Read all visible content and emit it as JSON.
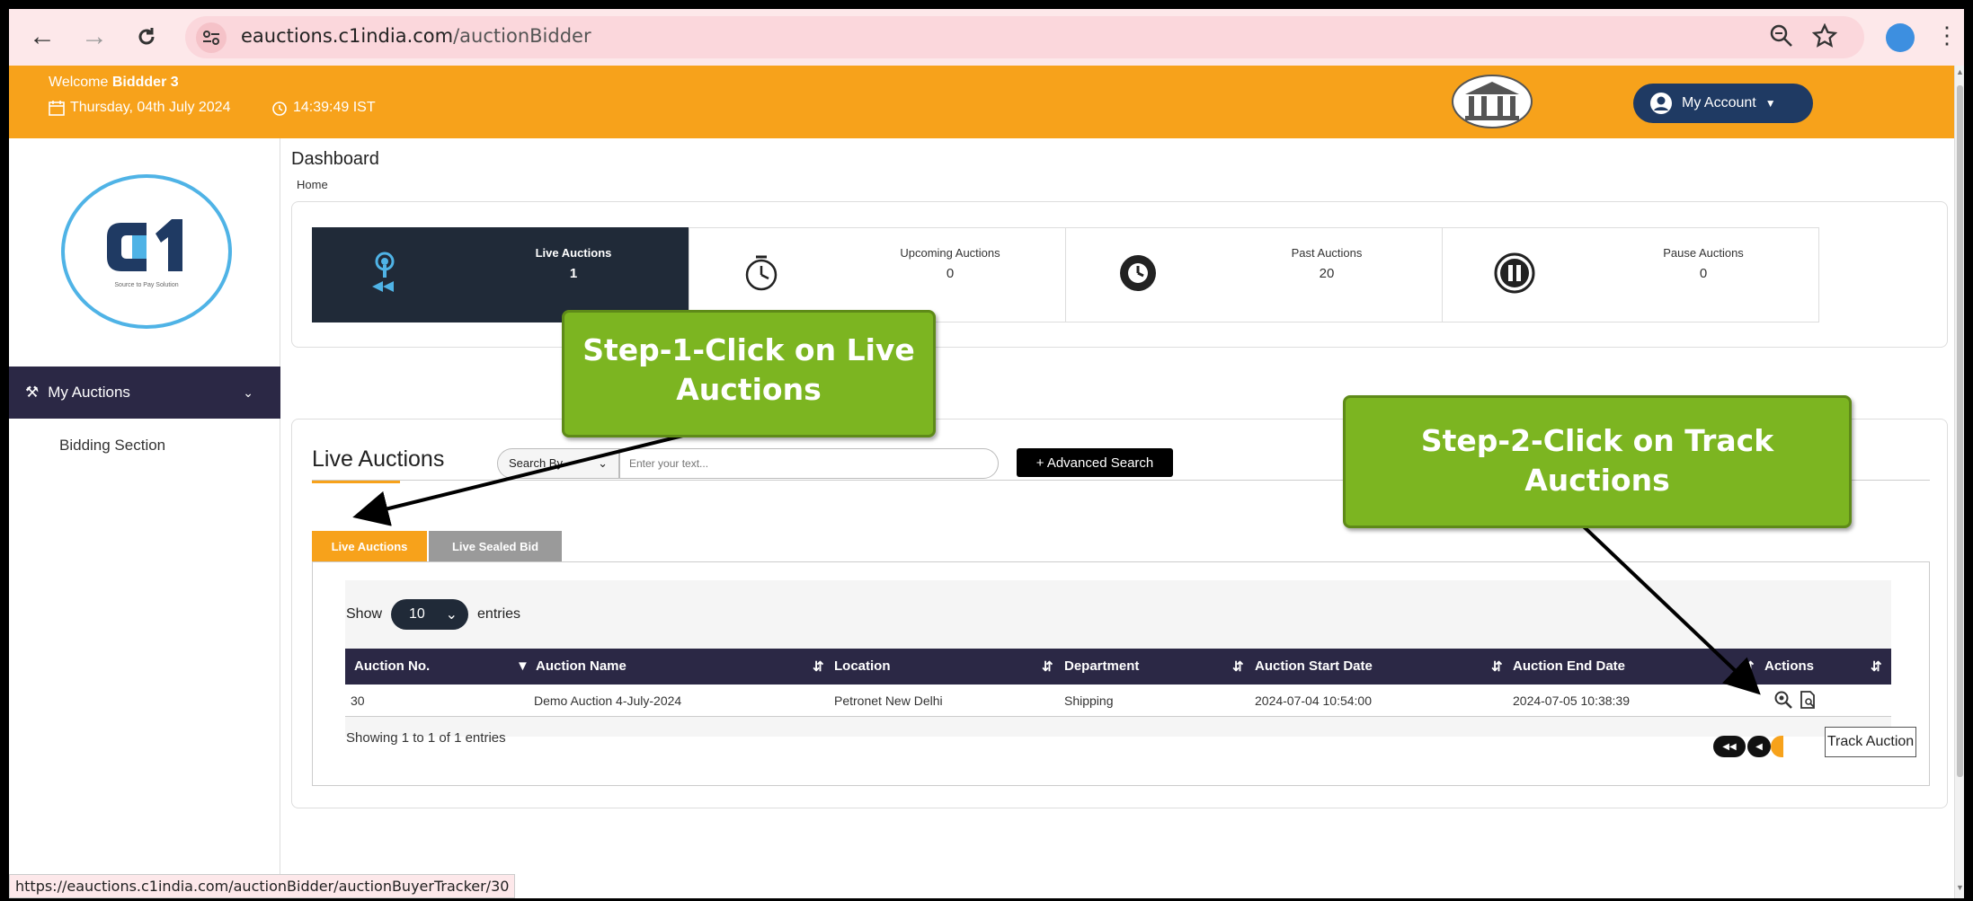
{
  "browser": {
    "url_domain": "eauctions.c1india.com",
    "url_path": "/auctionBidder",
    "status_url": "https://eauctions.c1india.com/auctionBidder/auctionBuyerTracker/30"
  },
  "header": {
    "welcome_prefix": "Welcome ",
    "user_name": "Biddder 3",
    "date": "Thursday, 04th July 2024",
    "time": "14:39:49 IST",
    "account_label": "My Account",
    "accent_color": "#f7a21b"
  },
  "sidebar": {
    "logo_tagline": "Source to Pay Solution",
    "menu_label": "My Auctions",
    "sub_item": "Bidding Section"
  },
  "page": {
    "title": "Dashboard",
    "breadcrumb": "Home"
  },
  "stats": [
    {
      "label": "Live Auctions",
      "value": "1",
      "icon": "live-broadcast-icon"
    },
    {
      "label": "Upcoming Auctions",
      "value": "0",
      "icon": "stopwatch-icon"
    },
    {
      "label": "Past Auctions",
      "value": "20",
      "icon": "history-clock-icon"
    },
    {
      "label": "Pause Auctions",
      "value": "0",
      "icon": "pause-icon"
    }
  ],
  "live": {
    "title": "Live Auctions",
    "search_by": "Search By",
    "search_placeholder": "Enter your text...",
    "advanced_search": "+ Advanced Search",
    "tabs": [
      "Live Auctions",
      "Live Sealed Bid"
    ],
    "show_label": "Show",
    "entries_value": "10",
    "entries_label": "entries",
    "columns": [
      "Auction No.",
      "Auction Name",
      "Location",
      "Department",
      "Auction Start Date",
      "Auction End Date",
      "Actions"
    ],
    "rows": [
      {
        "no": "30",
        "name": "Demo Auction 4-July-2024",
        "location": "Petronet New Delhi",
        "department": "Shipping",
        "start": "2024-07-04 10:54:00",
        "end": "2024-07-05 10:38:39"
      }
    ],
    "showing": "Showing 1 to 1 of 1 entries",
    "tooltip": "Track Auction"
  },
  "callouts": {
    "step1": "Step-1-Click on Live Auctions",
    "step2": "Step-2-Click on Track Auctions"
  }
}
